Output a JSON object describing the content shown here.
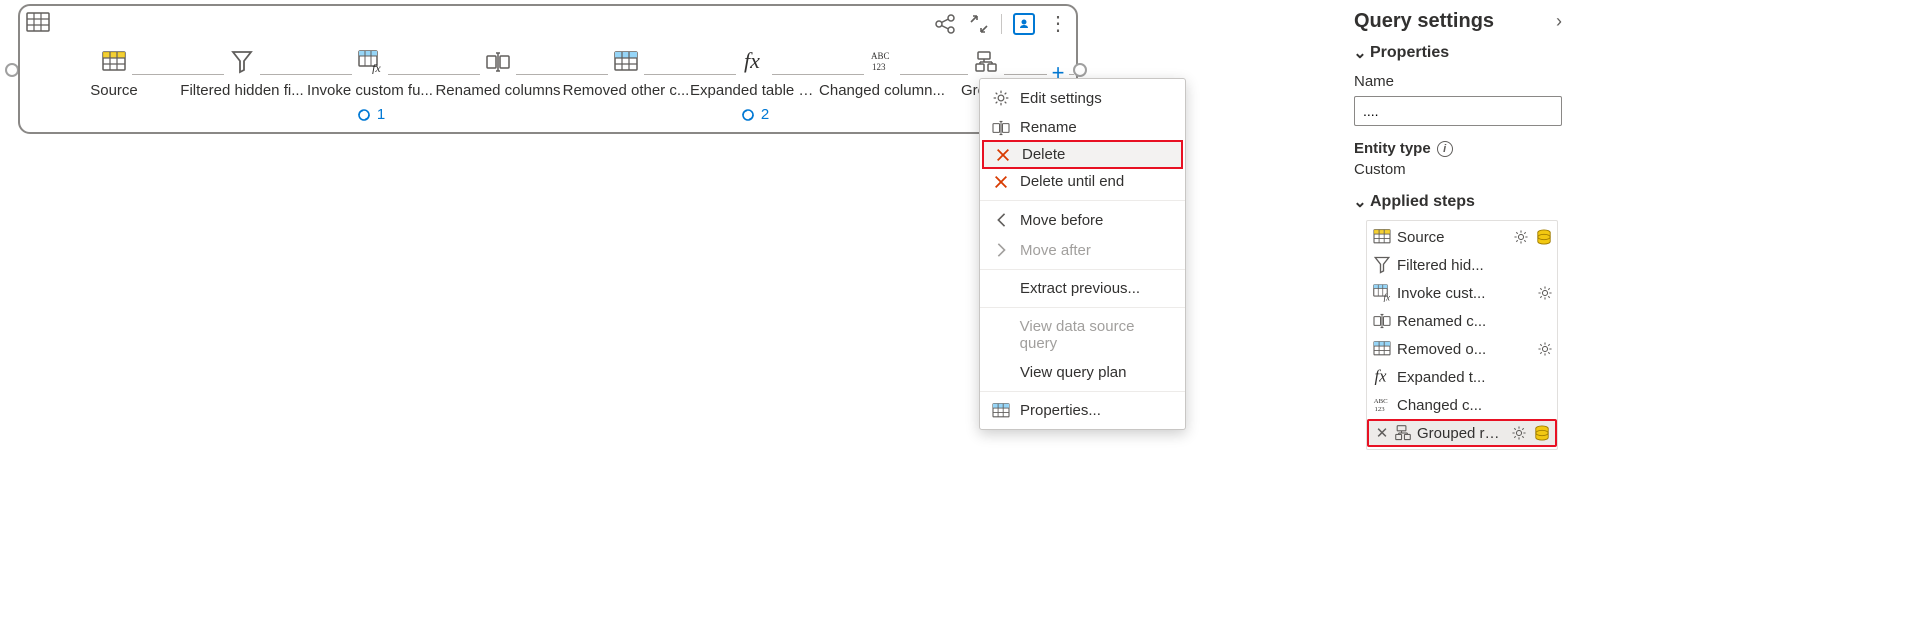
{
  "canvas": {
    "steps": [
      {
        "label": "Source",
        "icon": "table-yellow"
      },
      {
        "label": "Filtered hidden fi...",
        "icon": "funnel"
      },
      {
        "label": "Invoke custom fu...",
        "icon": "table-fx",
        "badge": "1"
      },
      {
        "label": "Renamed columns",
        "icon": "rename"
      },
      {
        "label": "Removed other c...",
        "icon": "table-blue"
      },
      {
        "label": "Expanded table c...",
        "icon": "fx",
        "badge": "2"
      },
      {
        "label": "Changed column...",
        "icon": "abc123"
      },
      {
        "label": "Groupe",
        "icon": "group"
      }
    ]
  },
  "context_menu": {
    "items": [
      {
        "label": "Edit settings",
        "icon": "gear"
      },
      {
        "label": "Rename",
        "icon": "rename"
      },
      {
        "label": "Delete",
        "icon": "x-red",
        "highlight": true
      },
      {
        "label": "Delete until end",
        "icon": "x-red"
      },
      {
        "sep": true
      },
      {
        "label": "Move before",
        "icon": "chev-left"
      },
      {
        "label": "Move after",
        "icon": "chev-right",
        "disabled": true
      },
      {
        "sep": true
      },
      {
        "label": "Extract previous..."
      },
      {
        "sep": true
      },
      {
        "label": "View data source query",
        "disabled": true
      },
      {
        "label": "View query plan"
      },
      {
        "sep": true
      },
      {
        "label": "Properties...",
        "icon": "table-blue"
      }
    ]
  },
  "side_panel": {
    "title": "Query settings",
    "properties_label": "Properties",
    "name_label": "Name",
    "name_value": "....",
    "entity_type_label": "Entity type",
    "entity_type_value": "Custom",
    "applied_steps_label": "Applied steps",
    "steps": [
      {
        "label": "Source",
        "icon": "table-yellow",
        "gear": true,
        "db": true
      },
      {
        "label": "Filtered hid...",
        "icon": "funnel"
      },
      {
        "label": "Invoke cust...",
        "icon": "table-fx",
        "gear": true
      },
      {
        "label": "Renamed c...",
        "icon": "rename"
      },
      {
        "label": "Removed o...",
        "icon": "table-blue",
        "gear": true
      },
      {
        "label": "Expanded t...",
        "icon": "fx"
      },
      {
        "label": "Changed c...",
        "icon": "abc123"
      },
      {
        "label": "Grouped ro...",
        "icon": "group",
        "gear": true,
        "db": true,
        "selected": true,
        "x": true
      }
    ]
  }
}
